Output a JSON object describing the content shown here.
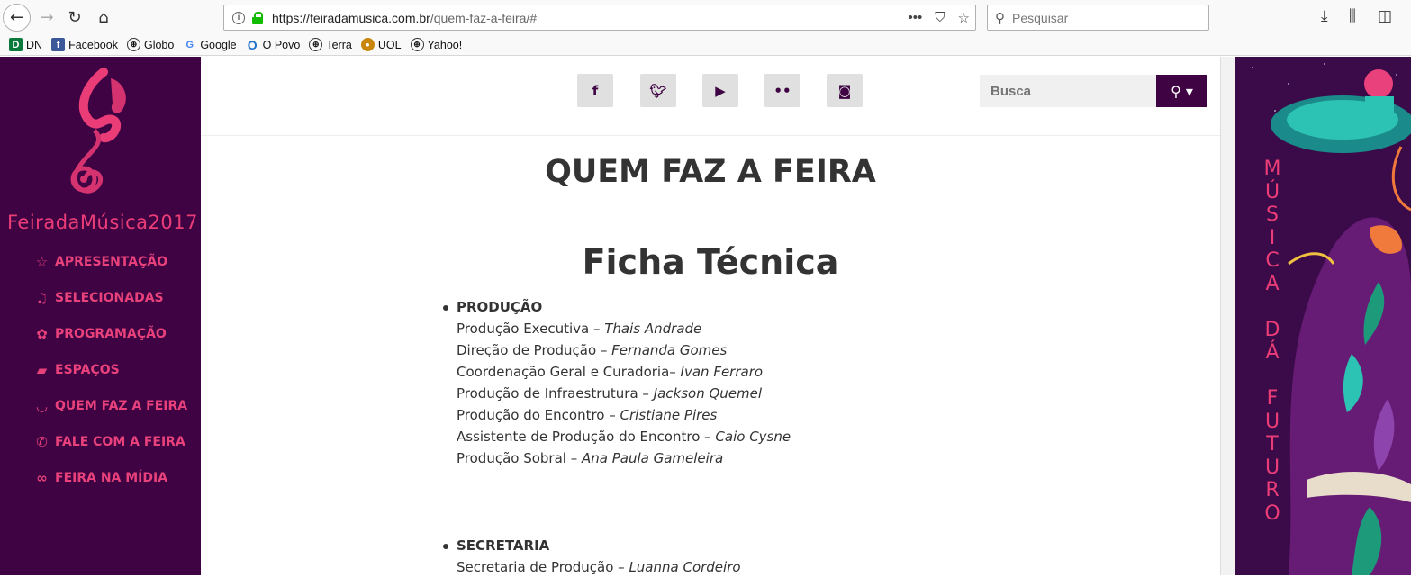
{
  "browser": {
    "url_domain": "https://feiradamusica.com.br",
    "url_path": "/quem-faz-a-feira/#",
    "search_placeholder": "Pesquisar",
    "bookmarks": [
      {
        "label": "DN",
        "icon": "dn-icon"
      },
      {
        "label": "Facebook",
        "icon": "facebook-icon"
      },
      {
        "label": "Globo",
        "icon": "globe-icon"
      },
      {
        "label": "Google",
        "icon": "google-icon"
      },
      {
        "label": "O Povo",
        "icon": "opovo-icon"
      },
      {
        "label": "Terra",
        "icon": "globe-icon"
      },
      {
        "label": "UOL",
        "icon": "uol-icon"
      },
      {
        "label": "Yahoo!",
        "icon": "globe-icon"
      }
    ]
  },
  "sidebar": {
    "logo_text": "FeiradaMúsica2017",
    "menu": [
      {
        "label": "APRESENTAÇÃO",
        "icon": "star-icon"
      },
      {
        "label": "SELECIONADAS",
        "icon": "music-icon"
      },
      {
        "label": "PROGRAMAÇÃO",
        "icon": "paw-icon"
      },
      {
        "label": "ESPAÇOS",
        "icon": "map-icon"
      },
      {
        "label": "QUEM FAZ A FEIRA",
        "icon": "smile-icon"
      },
      {
        "label": "FALE COM A FEIRA",
        "icon": "phone-icon"
      },
      {
        "label": "FEIRA NA MÍDIA",
        "icon": "link-icon"
      }
    ]
  },
  "header": {
    "social": [
      "facebook-icon",
      "twitter-icon",
      "youtube-icon",
      "flickr-icon",
      "instagram-icon"
    ],
    "search_placeholder": "Busca"
  },
  "content": {
    "title": "QUEM FAZ A FEIRA",
    "subtitle": "Ficha Técnica",
    "sections": [
      {
        "heading": "PRODUÇÃO",
        "rows": [
          {
            "role": "Produção Executiva – ",
            "name": "Thais Andrade"
          },
          {
            "role": "Direção de Produção – ",
            "name": "Fernanda Gomes"
          },
          {
            "role": "Coordenação Geral e Curadoria– ",
            "name": "Ivan Ferraro"
          },
          {
            "role": "Produção de Infraestrutura – ",
            "name": "Jackson Quemel"
          },
          {
            "role": "Produção do Encontro – ",
            "name": "Cristiane Pires"
          },
          {
            "role": "Assistente de Produção do Encontro – ",
            "name": "Caio Cysne"
          },
          {
            "role": "Produção Sobral – ",
            "name": "Ana Paula Gameleira"
          }
        ]
      },
      {
        "heading": "SECRETARIA",
        "rows": [
          {
            "role": "Secretaria de Produção – ",
            "name": "Luanna Cordeiro"
          }
        ]
      }
    ]
  },
  "banner": {
    "letters": [
      "M",
      "Ú",
      "S",
      "I",
      "C",
      "A",
      " ",
      "D",
      "Á",
      " ",
      "F",
      "U",
      "T",
      "U",
      "R",
      "O"
    ]
  }
}
